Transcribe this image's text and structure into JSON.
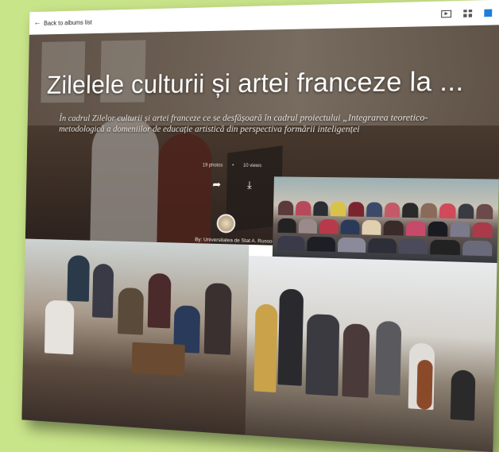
{
  "nav": {
    "back_label": "Back to albums list"
  },
  "toolbar_icons": [
    "slideshow-icon",
    "grid-view-icon",
    "app-square-icon"
  ],
  "album": {
    "title": "Zilelele culturii și artei franceze la ...",
    "description": "În cadrul Zilelor culturii și artei franceze ce se desfășoară în cadrul proiectului „Integrarea teoretico-metodologică a domeniilor de educație artistică din perspectiva formării inteligenței",
    "photos": "19 photos",
    "views": "10 views",
    "byline": "By: Universitatea de Stat A. Russo"
  },
  "colors": {
    "background": "#c9e58a",
    "accent": "#1e7fd8"
  }
}
